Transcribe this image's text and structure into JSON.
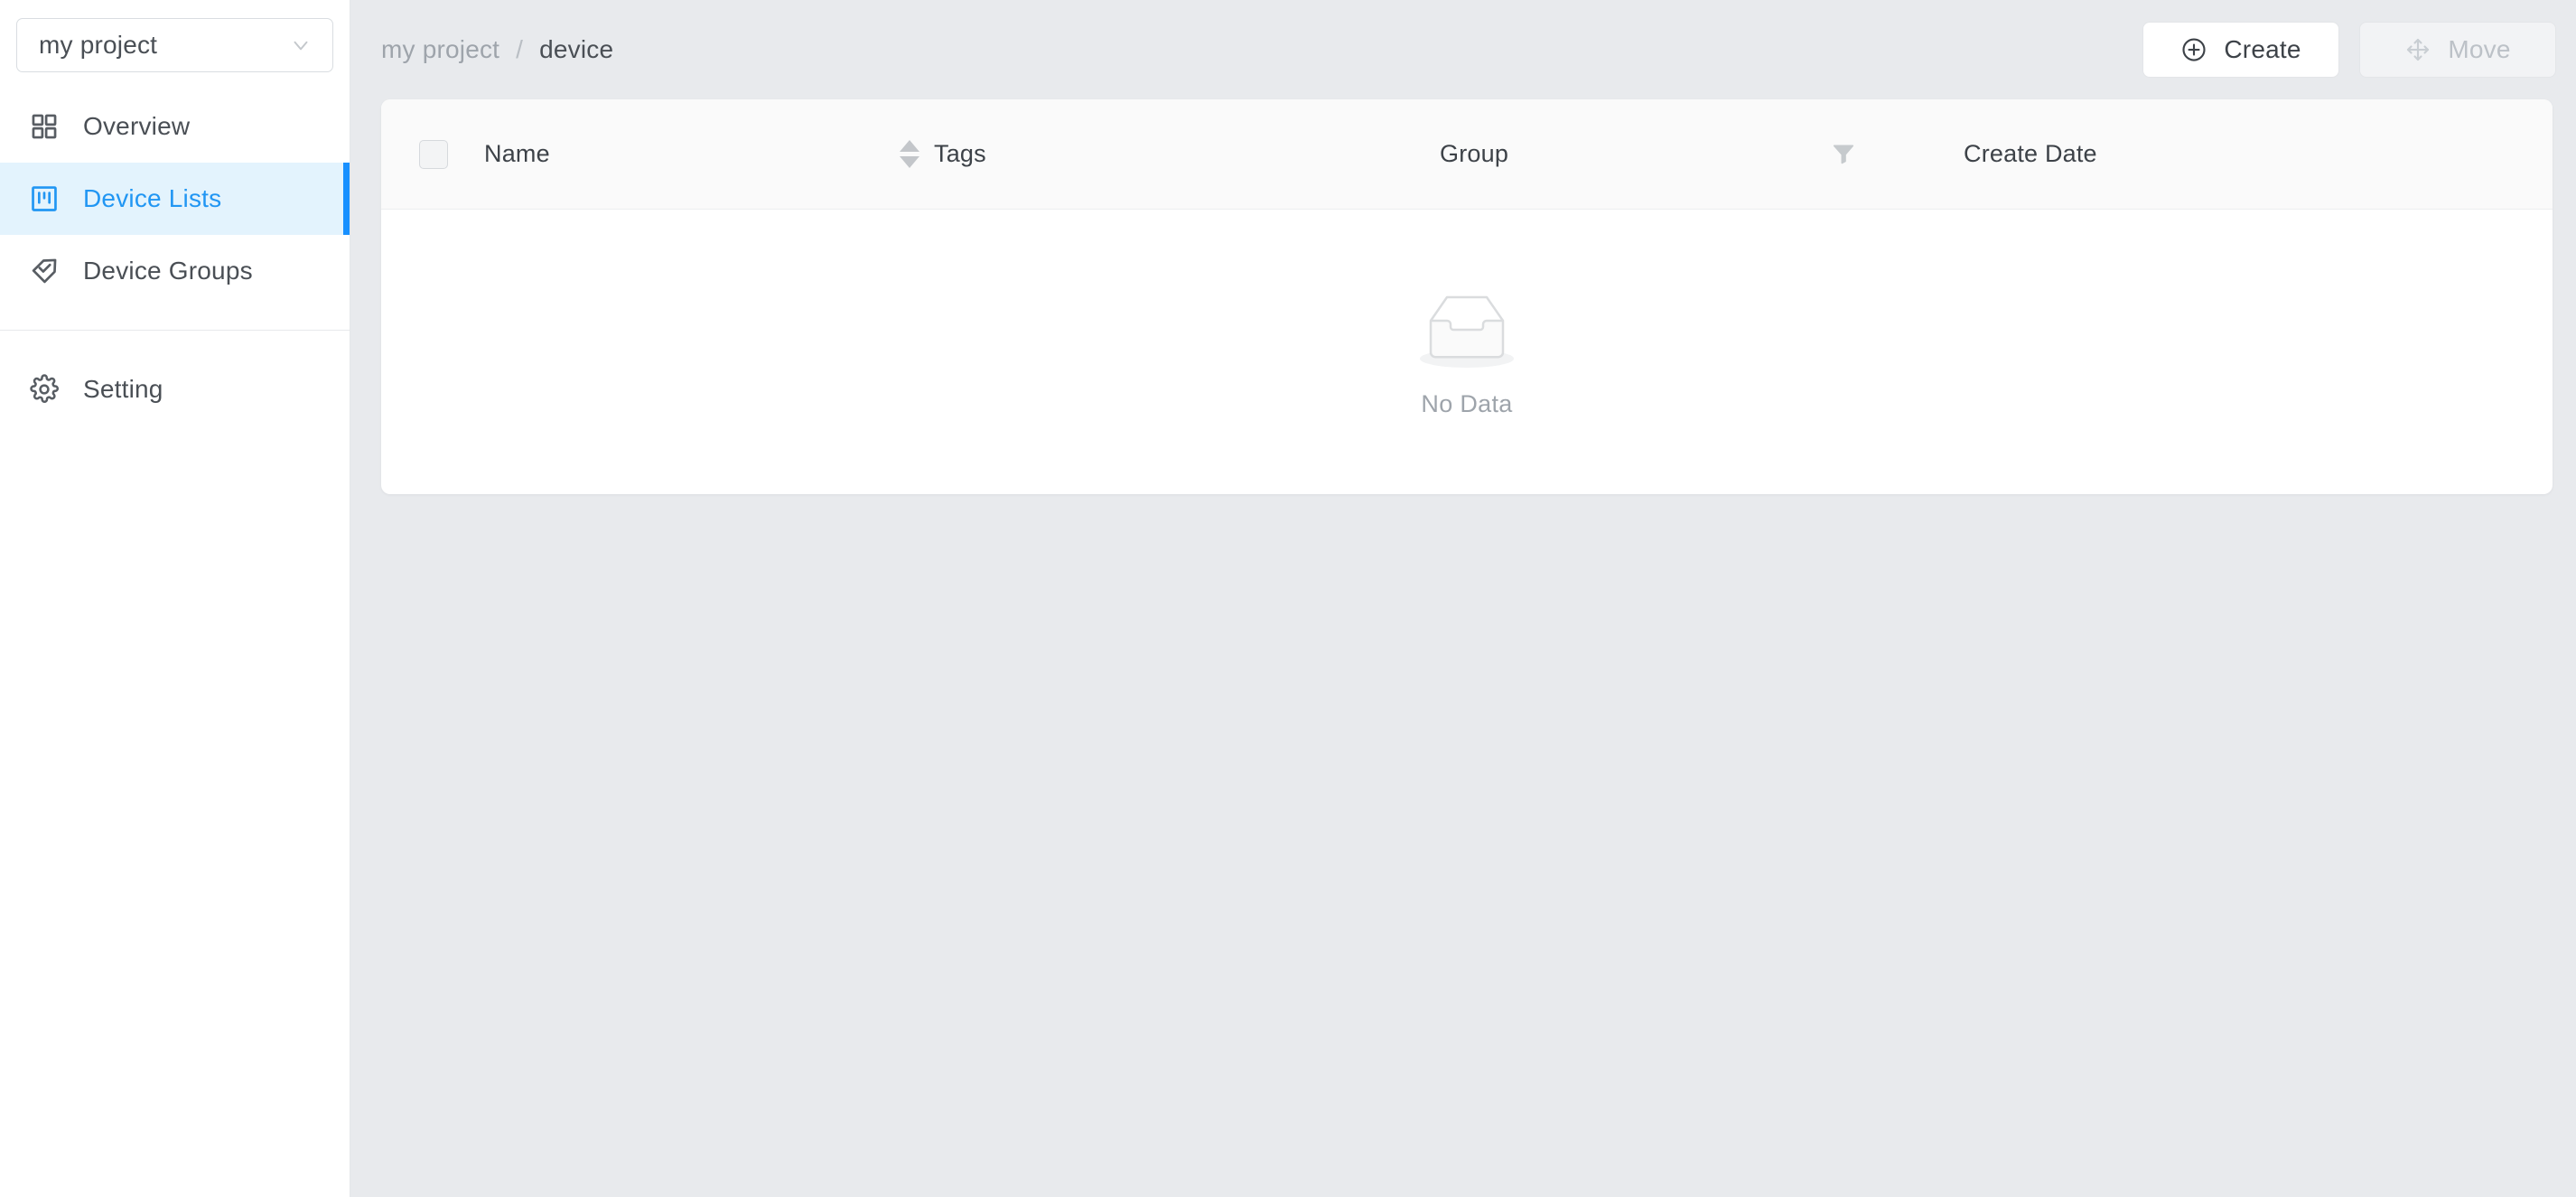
{
  "sidebar": {
    "project_selector": {
      "value": "my project",
      "icon": "chevron-down-icon"
    },
    "items": [
      {
        "label": "Overview",
        "icon": "grid-icon",
        "active": false
      },
      {
        "label": "Device Lists",
        "icon": "kanban-icon",
        "active": true
      },
      {
        "label": "Device Groups",
        "icon": "tag-check-icon",
        "active": false
      },
      {
        "label": "Setting",
        "icon": "gear-icon",
        "active": false
      }
    ]
  },
  "topbar": {
    "breadcrumb": {
      "root": "my project",
      "separator": "/",
      "current": "device"
    },
    "create_button": {
      "label": "Create",
      "icon": "plus-circle-icon",
      "disabled": false
    },
    "move_button": {
      "label": "Move",
      "icon": "move-arrows-icon",
      "disabled": true
    }
  },
  "table": {
    "columns": [
      {
        "key": "select",
        "label": "",
        "icon": "checkbox-icon"
      },
      {
        "key": "name",
        "label": "Name",
        "icon": "sort-arrows-icon"
      },
      {
        "key": "tags",
        "label": "Tags",
        "icon": ""
      },
      {
        "key": "group",
        "label": "Group",
        "icon": "filter-icon"
      },
      {
        "key": "date",
        "label": "Create Date",
        "icon": ""
      }
    ],
    "rows": [],
    "empty": {
      "text": "No Data",
      "icon": "empty-inbox-icon"
    }
  },
  "colors": {
    "accent": "#1890ff",
    "active_bg": "#e3f3fd",
    "active_text": "#2196f3",
    "page_bg": "#e8eaed",
    "card_bg": "#ffffff",
    "header_bg": "#fafafa",
    "text_primary": "#3d4248",
    "text_muted": "#9ea4ab",
    "disabled_text": "#bcc1c7"
  }
}
